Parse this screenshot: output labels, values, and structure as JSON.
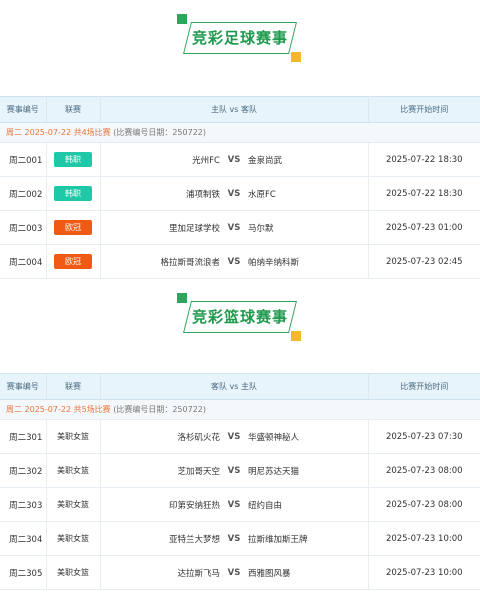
{
  "football": {
    "title": "竞彩足球赛事",
    "headers": {
      "no": "赛事编号",
      "league": "联赛",
      "match": "主队 vs 客队",
      "time": "比赛开始时间"
    },
    "date_text": "周二 2025-07-22 共4场比赛",
    "date_note": "(比赛编号日期：250722)",
    "games": [
      {
        "no": "周二001",
        "league": "韩职",
        "league_color": "#1fc9a8",
        "home": "光州FC",
        "away": "金泉尚武",
        "time": "2025-07-22 18:30"
      },
      {
        "no": "周二002",
        "league": "韩职",
        "league_color": "#1fc9a8",
        "home": "浦项制铁",
        "away": "水原FC",
        "time": "2025-07-22 18:30"
      },
      {
        "no": "周二003",
        "league": "欧冠",
        "league_color": "#f05a14",
        "home": "里加足球学校",
        "away": "马尔默",
        "time": "2025-07-23 01:00"
      },
      {
        "no": "周二004",
        "league": "欧冠",
        "league_color": "#f05a14",
        "home": "格拉斯哥流浪者",
        "away": "帕纳辛纳科斯",
        "time": "2025-07-23 02:45"
      }
    ]
  },
  "basketball": {
    "title": "竞彩篮球赛事",
    "headers": {
      "no": "赛事编号",
      "league": "联赛",
      "match": "客队 vs 主队",
      "time": "比赛开始时间"
    },
    "date_text": "周二 2025-07-22 共5场比赛",
    "date_note": "(比赛编号日期：250722)",
    "games": [
      {
        "no": "周二301",
        "league": "美职女篮",
        "home": "洛杉矶火花",
        "away": "华盛顿神秘人",
        "time": "2025-07-23 07:30"
      },
      {
        "no": "周二302",
        "league": "美职女篮",
        "home": "芝加哥天空",
        "away": "明尼苏达天猫",
        "time": "2025-07-23 08:00"
      },
      {
        "no": "周二303",
        "league": "美职女篮",
        "home": "印第安纳狂热",
        "away": "纽约自由",
        "time": "2025-07-23 08:00"
      },
      {
        "no": "周二304",
        "league": "美职女篮",
        "home": "亚特兰大梦想",
        "away": "拉斯维加斯王牌",
        "time": "2025-07-23 10:00"
      },
      {
        "no": "周二305",
        "league": "美职女篮",
        "home": "达拉斯飞马",
        "away": "西雅图风暴",
        "time": "2025-07-23 10:00"
      }
    ]
  },
  "vs_label": "VS"
}
